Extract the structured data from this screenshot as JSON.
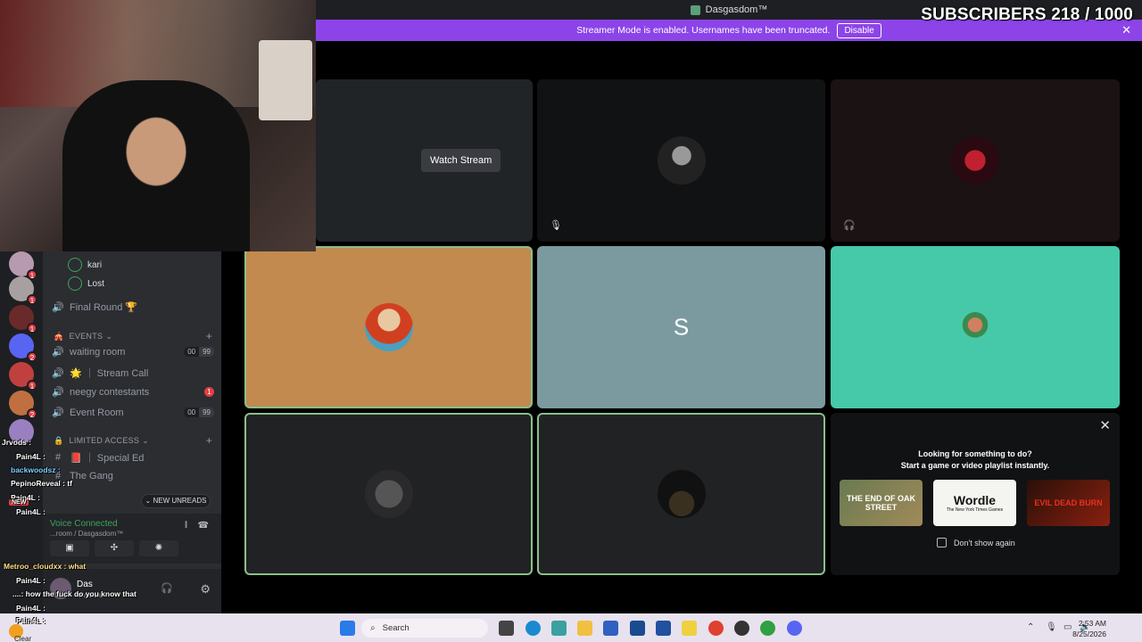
{
  "overlay": {
    "subscribers_text": "SUBSCRIBERS 218 / 1000"
  },
  "window": {
    "title": "Dasgasdom™"
  },
  "banner": {
    "text": "Streamer Mode is enabled. Usernames have been truncated.",
    "disable_label": "Disable",
    "close_icon": "✕"
  },
  "sidebar": {
    "voice_users": [
      "kari",
      "Lost"
    ],
    "channel_final_round": "Final Round 🏆",
    "events_category": "EVENTS",
    "waiting_room": {
      "label": "waiting room",
      "count": "00",
      "limit": "99"
    },
    "stream_call": "🌟 ｜ Stream Call",
    "neegy": {
      "label": "neegy contestants",
      "badge": "1"
    },
    "event_room": {
      "label": "Event Room",
      "count": "00",
      "limit": "99"
    },
    "limited_category": "LIMITED ACCESS",
    "special_ed": "📕 ｜ Special Ed",
    "the_gang": "The Gang",
    "new_unreads": "NEW UNREADS",
    "voice_connected": "Voice Connected",
    "voice_sub": "...room / Dasgasdom™",
    "user_name": "Das",
    "user_status": "Invisible"
  },
  "guild_badges": [
    "1",
    "1",
    "1",
    "2",
    "1",
    "2"
  ],
  "chat": [
    {
      "text": "Jrvods :"
    },
    {
      "text": "Pain4L :"
    },
    {
      "text": "backwoodsz :"
    },
    {
      "text": "PepinoReveal : tf"
    },
    {
      "text": "Pain4L :"
    },
    {
      "text": "NEW"
    },
    {
      "text": "Pain4L :"
    },
    {
      "text": "Metroo_cloudxx : what"
    },
    {
      "text": "Pain4L :"
    },
    {
      "text": "....: how the fuck do you know that"
    },
    {
      "text": "Pain4L :"
    },
    {
      "text": "Pain4L :"
    }
  ],
  "tiles": {
    "watch_stream_label": "Watch Stream",
    "letter_tile": "S"
  },
  "activity": {
    "heading": "Looking for something to do?",
    "subheading": "Start a game or video playlist instantly.",
    "games": [
      "THE END OF OAK STREET",
      "Wordle",
      "EVIL DEAD BURN"
    ],
    "wordle_sub": "The New York Times Games",
    "dont_show": "Don't show again",
    "close_icon": "✕"
  },
  "taskbar": {
    "search_placeholder": "Search",
    "time": "2:53 AM",
    "date": "8/25/2026",
    "weather": "Clear"
  },
  "colors": {
    "banner": "#8c44e8",
    "tile_orange": "#c28a4e",
    "tile_slate": "#7b9aa0",
    "tile_teal": "#46c9a8",
    "speaking": "#8bbf8b"
  }
}
